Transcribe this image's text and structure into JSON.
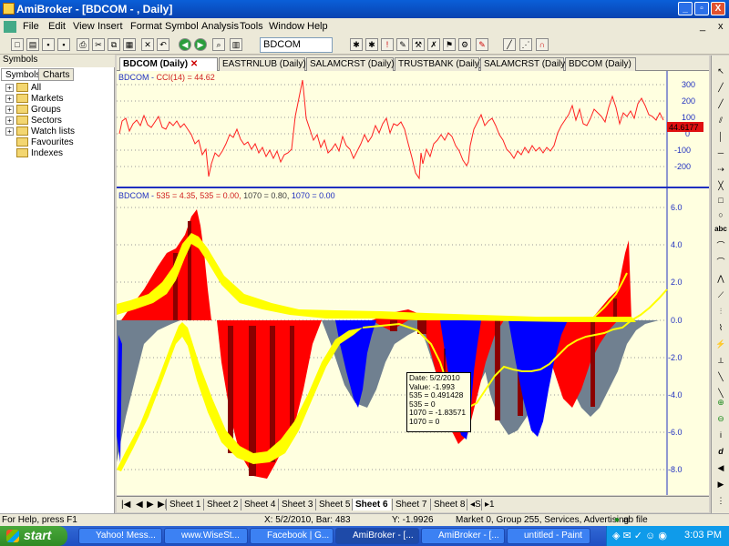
{
  "window": {
    "title": "AmiBroker - [BDCOM - , Daily]",
    "buttons": [
      "_",
      "▫",
      "X"
    ]
  },
  "menu": [
    "File",
    "Edit",
    "View",
    "Insert",
    "Format",
    "Symbol",
    "Analysis",
    "Tools",
    "Window",
    "Help"
  ],
  "toolbar": {
    "symbol": "BDCOM"
  },
  "left_panel": {
    "title": "Symbols",
    "tabs": [
      "Symbols",
      "Charts"
    ],
    "tree": [
      {
        "label": "All",
        "expandable": true
      },
      {
        "label": "Markets",
        "expandable": true
      },
      {
        "label": "Groups",
        "expandable": true
      },
      {
        "label": "Sectors",
        "expandable": true
      },
      {
        "label": "Watch lists",
        "expandable": true
      },
      {
        "label": "Favourites",
        "expandable": false
      },
      {
        "label": "Indexes",
        "expandable": false
      }
    ]
  },
  "doc_tabs": [
    "BDCOM (Daily)",
    "EASTRNLUB (Daily)",
    "SALAMCRST (Daily)",
    "TRUSTBANK (Daily)",
    "SALAMCRST (Daily)",
    "BDCOM (Daily)"
  ],
  "cci_pane": {
    "title_symbol": "BDCOM - ",
    "title_indicator": "CCI(14) = 44.62",
    "axis_ticks": [
      "300",
      "200",
      "100",
      "0",
      "-100",
      "-200"
    ],
    "value_badge": "44.6177",
    "line_color": "#ff0000"
  },
  "osc_pane": {
    "title_symbol": "BDCOM - ",
    "title_parts": [
      "535 = 4.35, ",
      "535 = 0.00, ",
      "1070 = 0.80, ",
      "1070 = 0.00"
    ],
    "axis_ticks": [
      "6.0",
      "4.0",
      "2.0",
      "0.0",
      "-2.0",
      "-4.0",
      "-6.0",
      "-8.0"
    ]
  },
  "tooltip": [
    "Date: 5/2/2010",
    "Value: -1.993",
    "535 = 0.491428",
    "535 = 0",
    "1070 = -1.83571",
    "1070 = 0"
  ],
  "sheets": [
    "Sheet 1",
    "Sheet 2",
    "Sheet 4",
    "Sheet 3",
    "Sheet 5",
    "Sheet 6",
    "Sheet 7",
    "Sheet 8"
  ],
  "sheet_nav": [
    "◂S",
    "▸1"
  ],
  "status": {
    "help": "For Help, press F1",
    "xinfo": "X: 5/2/2010, Bar: 483",
    "yinfo": "Y: -1.9926",
    "market": "Market 0, Group 255, Services, Advertising",
    "file": "ab file"
  },
  "taskbar": {
    "start": "start",
    "tasks": [
      "Yahoo! Mess...",
      "www.WiseSt...",
      "Facebook | G...",
      "AmiBroker - [...",
      "AmiBroker - [...",
      "untitled - Paint"
    ],
    "clock": "3:03 PM"
  }
}
